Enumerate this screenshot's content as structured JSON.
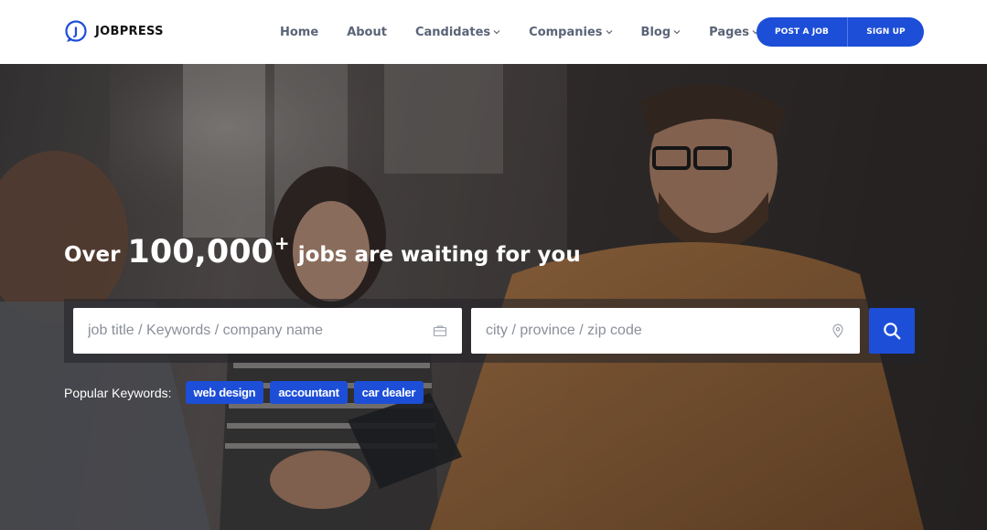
{
  "brand": {
    "logo_letter": "J",
    "name": "JOBPRESS",
    "accent": "#1d4ed8"
  },
  "nav": {
    "items": [
      {
        "label": "Home",
        "has_dropdown": false
      },
      {
        "label": "About",
        "has_dropdown": false
      },
      {
        "label": "Candidates",
        "has_dropdown": true
      },
      {
        "label": "Companies",
        "has_dropdown": true
      },
      {
        "label": "Blog",
        "has_dropdown": true
      },
      {
        "label": "Pages",
        "has_dropdown": true
      }
    ],
    "post_job_label": "POST A JOB",
    "sign_up_label": "SIGN UP"
  },
  "hero": {
    "headline_prefix": "Over",
    "headline_number": "100,000",
    "headline_sup": "+",
    "headline_suffix": "jobs are waiting for you",
    "keyword_placeholder": "job title / Keywords / company name",
    "location_placeholder": "city / province / zip code",
    "keyword_icon": "briefcase-icon",
    "location_icon": "map-pin-icon",
    "search_icon": "search-icon",
    "popular_label": "Popular Keywords:",
    "popular_keywords": [
      "web design",
      "accountant",
      "car dealer"
    ]
  },
  "colors": {
    "primary": "#1d4ed8",
    "nav_text": "#5a6477"
  }
}
